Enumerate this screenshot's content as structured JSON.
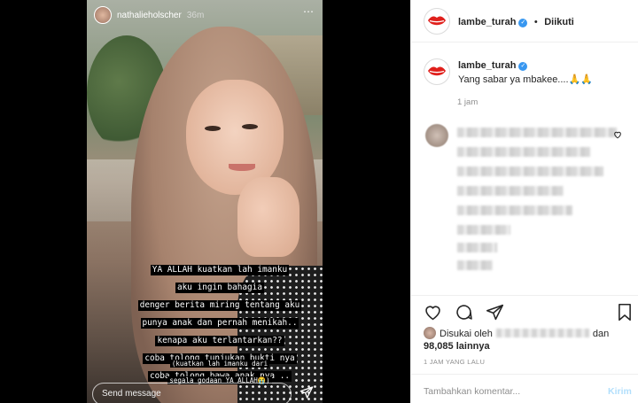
{
  "story": {
    "username": "nathalieholscher",
    "time": "36m",
    "caption_lines": [
      "YA ALLAH kuatkan lah imanku",
      "aku ingin bahagia",
      "denger berita miring tentang aku",
      "punya anak dan pernah menikah..",
      "kenapa aku terlantarkan??",
      "coba tolong tunjukan bukti nya",
      "coba tolong bawa anak nya .."
    ],
    "small_lines": [
      "(kuatkan lah imanku dari",
      "segala godaan YA ALLAH😭)"
    ],
    "send_placeholder": "Send message",
    "more_icon": "⋯"
  },
  "post": {
    "author": "lambe_turah",
    "verified_mark": "✓",
    "separator": "•",
    "follow_status": "Diikuti",
    "caption": "Yang sabar ya mbakee....🙏🙏",
    "caption_time": "1 jam",
    "liked_by_prefix": "Disukai oleh",
    "liked_by_and": "dan",
    "likes_count": "98,085",
    "likes_suffix": "lainnya",
    "posted_ago": "1 JAM YANG LALU",
    "comment_placeholder": "Tambahkan komentar...",
    "post_button": "Kirim"
  },
  "icons": {
    "like": "heart-icon",
    "comment": "comment-icon",
    "share": "share-icon",
    "save": "bookmark-icon",
    "send": "send-icon"
  },
  "colors": {
    "link_blue": "#3897f0",
    "post_disabled": "#b2dffc",
    "logo_red": "#e0201c"
  }
}
